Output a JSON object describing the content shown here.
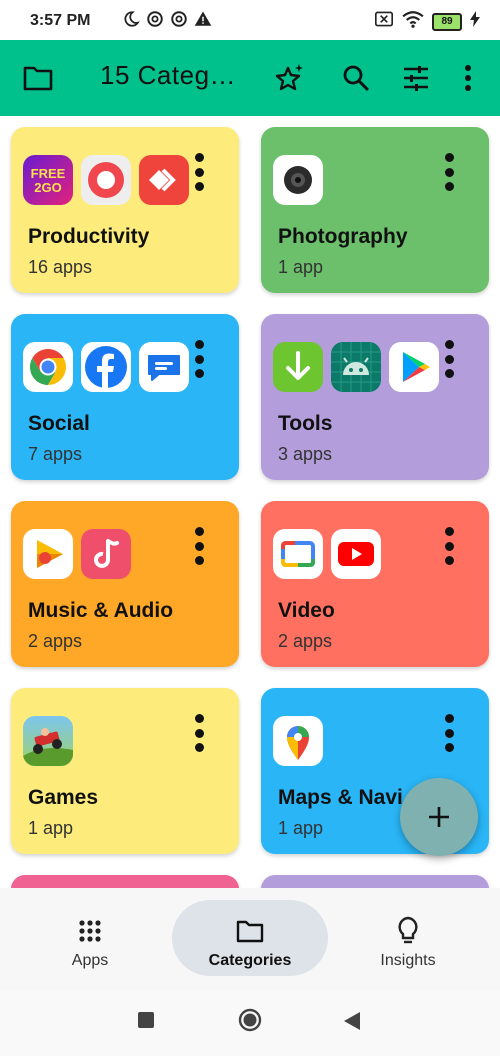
{
  "status_bar": {
    "time": "3:57 PM",
    "battery": "89",
    "icons": [
      "moon-icon",
      "data-saver-icon",
      "data-saver-icon",
      "warning-icon",
      "screen-close-icon",
      "wifi-icon",
      "charging-icon"
    ]
  },
  "app_bar": {
    "title": "15 Categ…",
    "icons": [
      "folder-icon",
      "star-sparkle-icon",
      "search-icon",
      "tune-icon",
      "more-vert-icon"
    ]
  },
  "categories": [
    {
      "name": "Productivity",
      "count": "16 apps",
      "color": "#fdec7b",
      "icons": [
        "free2go-icon",
        "screen-recorder-icon",
        "anydesk-icon"
      ]
    },
    {
      "name": "Photography",
      "count": "1 app",
      "color": "#6cbf6b",
      "icons": [
        "camera-icon"
      ]
    },
    {
      "name": "Social",
      "count": "7 apps",
      "color": "#29b5f6",
      "icons": [
        "chrome-icon",
        "facebook-icon",
        "messages-icon"
      ]
    },
    {
      "name": "Tools",
      "count": "3 apps",
      "color": "#b39ddb",
      "icons": [
        "downloader-icon",
        "android-icon",
        "play-store-icon"
      ]
    },
    {
      "name": "Music & Audio",
      "count": "2 apps",
      "color": "#ffa726",
      "icons": [
        "podcasts-icon",
        "music-icon"
      ]
    },
    {
      "name": "Video",
      "count": "2 apps",
      "color": "#ff7061",
      "icons": [
        "tv-icon",
        "youtube-icon"
      ]
    },
    {
      "name": "Games",
      "count": "1 app",
      "color": "#fdec7b",
      "icons": [
        "hill-climb-icon"
      ]
    },
    {
      "name": "Maps & Navi",
      "count": "1 app",
      "color": "#29b5f6",
      "icons": [
        "maps-icon"
      ]
    },
    {
      "name": "",
      "count": "",
      "color": "#f06292",
      "icons": []
    },
    {
      "name": "",
      "count": "",
      "color": "#b39ddb",
      "icons": []
    }
  ],
  "fab": {
    "icon": "plus-icon"
  },
  "bottom_nav": {
    "items": [
      {
        "label": "Apps",
        "icon": "apps-grid-icon"
      },
      {
        "label": "Categories",
        "icon": "folder-icon"
      },
      {
        "label": "Insights",
        "icon": "lightbulb-icon"
      }
    ],
    "active": "Categories"
  },
  "system_nav": {
    "icons": [
      "recents-icon",
      "home-icon",
      "back-icon"
    ]
  }
}
